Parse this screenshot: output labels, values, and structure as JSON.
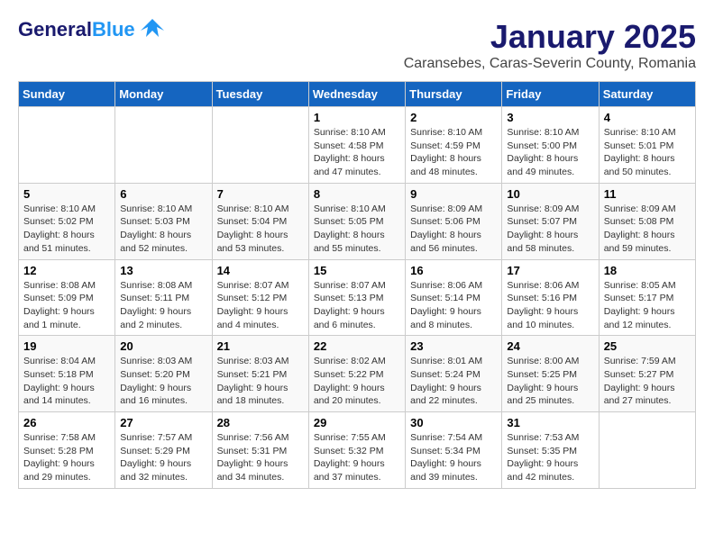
{
  "logo": {
    "line1": "General",
    "line2": "Blue"
  },
  "title": "January 2025",
  "subtitle": "Caransebes, Caras-Severin County, Romania",
  "weekdays": [
    "Sunday",
    "Monday",
    "Tuesday",
    "Wednesday",
    "Thursday",
    "Friday",
    "Saturday"
  ],
  "weeks": [
    [
      {
        "day": "",
        "info": ""
      },
      {
        "day": "",
        "info": ""
      },
      {
        "day": "",
        "info": ""
      },
      {
        "day": "1",
        "info": "Sunrise: 8:10 AM\nSunset: 4:58 PM\nDaylight: 8 hours\nand 47 minutes."
      },
      {
        "day": "2",
        "info": "Sunrise: 8:10 AM\nSunset: 4:59 PM\nDaylight: 8 hours\nand 48 minutes."
      },
      {
        "day": "3",
        "info": "Sunrise: 8:10 AM\nSunset: 5:00 PM\nDaylight: 8 hours\nand 49 minutes."
      },
      {
        "day": "4",
        "info": "Sunrise: 8:10 AM\nSunset: 5:01 PM\nDaylight: 8 hours\nand 50 minutes."
      }
    ],
    [
      {
        "day": "5",
        "info": "Sunrise: 8:10 AM\nSunset: 5:02 PM\nDaylight: 8 hours\nand 51 minutes."
      },
      {
        "day": "6",
        "info": "Sunrise: 8:10 AM\nSunset: 5:03 PM\nDaylight: 8 hours\nand 52 minutes."
      },
      {
        "day": "7",
        "info": "Sunrise: 8:10 AM\nSunset: 5:04 PM\nDaylight: 8 hours\nand 53 minutes."
      },
      {
        "day": "8",
        "info": "Sunrise: 8:10 AM\nSunset: 5:05 PM\nDaylight: 8 hours\nand 55 minutes."
      },
      {
        "day": "9",
        "info": "Sunrise: 8:09 AM\nSunset: 5:06 PM\nDaylight: 8 hours\nand 56 minutes."
      },
      {
        "day": "10",
        "info": "Sunrise: 8:09 AM\nSunset: 5:07 PM\nDaylight: 8 hours\nand 58 minutes."
      },
      {
        "day": "11",
        "info": "Sunrise: 8:09 AM\nSunset: 5:08 PM\nDaylight: 8 hours\nand 59 minutes."
      }
    ],
    [
      {
        "day": "12",
        "info": "Sunrise: 8:08 AM\nSunset: 5:09 PM\nDaylight: 9 hours\nand 1 minute."
      },
      {
        "day": "13",
        "info": "Sunrise: 8:08 AM\nSunset: 5:11 PM\nDaylight: 9 hours\nand 2 minutes."
      },
      {
        "day": "14",
        "info": "Sunrise: 8:07 AM\nSunset: 5:12 PM\nDaylight: 9 hours\nand 4 minutes."
      },
      {
        "day": "15",
        "info": "Sunrise: 8:07 AM\nSunset: 5:13 PM\nDaylight: 9 hours\nand 6 minutes."
      },
      {
        "day": "16",
        "info": "Sunrise: 8:06 AM\nSunset: 5:14 PM\nDaylight: 9 hours\nand 8 minutes."
      },
      {
        "day": "17",
        "info": "Sunrise: 8:06 AM\nSunset: 5:16 PM\nDaylight: 9 hours\nand 10 minutes."
      },
      {
        "day": "18",
        "info": "Sunrise: 8:05 AM\nSunset: 5:17 PM\nDaylight: 9 hours\nand 12 minutes."
      }
    ],
    [
      {
        "day": "19",
        "info": "Sunrise: 8:04 AM\nSunset: 5:18 PM\nDaylight: 9 hours\nand 14 minutes."
      },
      {
        "day": "20",
        "info": "Sunrise: 8:03 AM\nSunset: 5:20 PM\nDaylight: 9 hours\nand 16 minutes."
      },
      {
        "day": "21",
        "info": "Sunrise: 8:03 AM\nSunset: 5:21 PM\nDaylight: 9 hours\nand 18 minutes."
      },
      {
        "day": "22",
        "info": "Sunrise: 8:02 AM\nSunset: 5:22 PM\nDaylight: 9 hours\nand 20 minutes."
      },
      {
        "day": "23",
        "info": "Sunrise: 8:01 AM\nSunset: 5:24 PM\nDaylight: 9 hours\nand 22 minutes."
      },
      {
        "day": "24",
        "info": "Sunrise: 8:00 AM\nSunset: 5:25 PM\nDaylight: 9 hours\nand 25 minutes."
      },
      {
        "day": "25",
        "info": "Sunrise: 7:59 AM\nSunset: 5:27 PM\nDaylight: 9 hours\nand 27 minutes."
      }
    ],
    [
      {
        "day": "26",
        "info": "Sunrise: 7:58 AM\nSunset: 5:28 PM\nDaylight: 9 hours\nand 29 minutes."
      },
      {
        "day": "27",
        "info": "Sunrise: 7:57 AM\nSunset: 5:29 PM\nDaylight: 9 hours\nand 32 minutes."
      },
      {
        "day": "28",
        "info": "Sunrise: 7:56 AM\nSunset: 5:31 PM\nDaylight: 9 hours\nand 34 minutes."
      },
      {
        "day": "29",
        "info": "Sunrise: 7:55 AM\nSunset: 5:32 PM\nDaylight: 9 hours\nand 37 minutes."
      },
      {
        "day": "30",
        "info": "Sunrise: 7:54 AM\nSunset: 5:34 PM\nDaylight: 9 hours\nand 39 minutes."
      },
      {
        "day": "31",
        "info": "Sunrise: 7:53 AM\nSunset: 5:35 PM\nDaylight: 9 hours\nand 42 minutes."
      },
      {
        "day": "",
        "info": ""
      }
    ]
  ]
}
